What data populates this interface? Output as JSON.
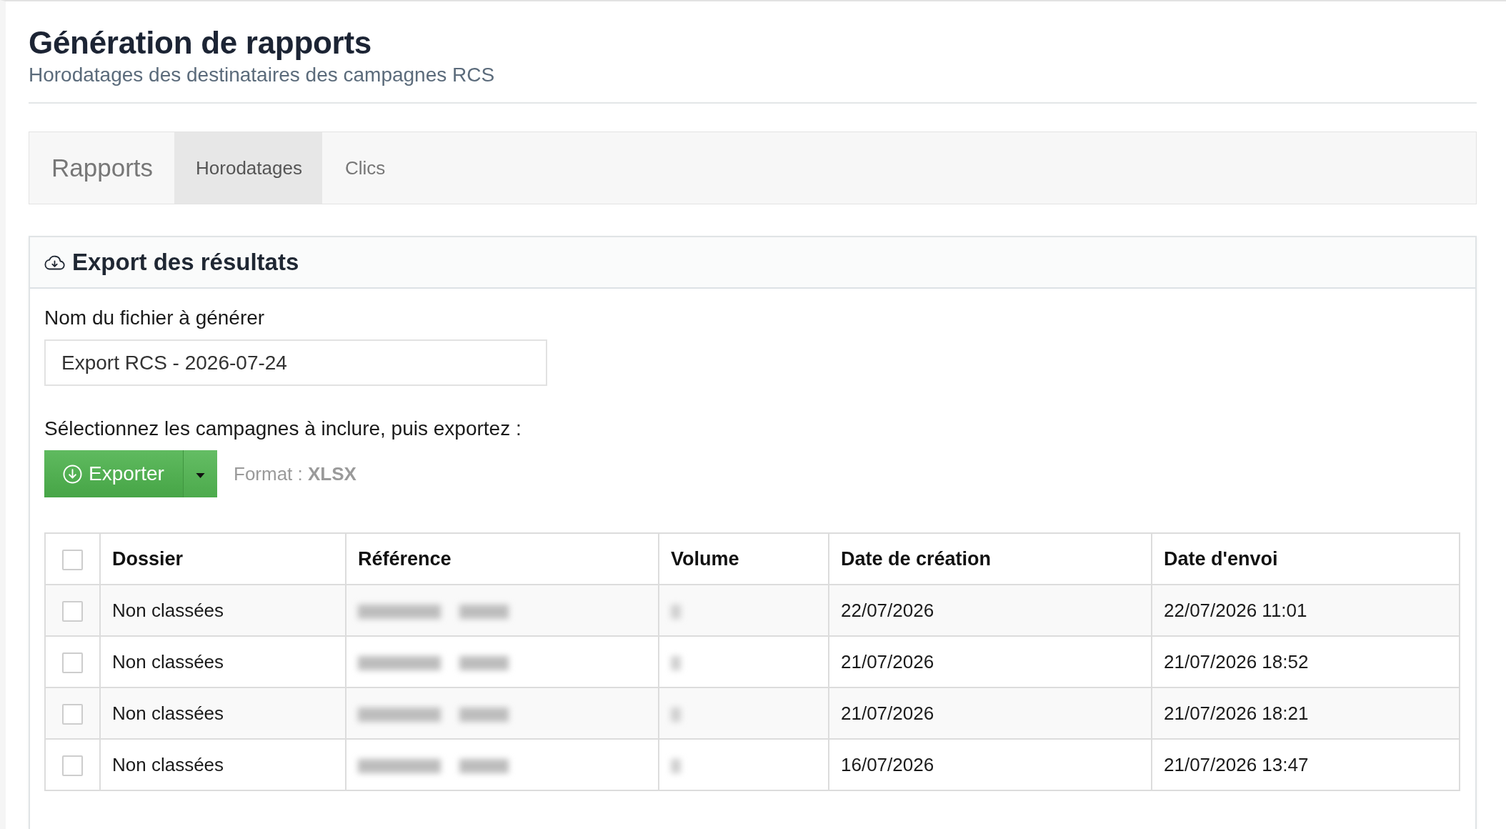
{
  "header": {
    "title": "Génération de rapports",
    "subtitle": "Horodatages des destinataires des campagnes RCS"
  },
  "nav": {
    "brand": "Rapports",
    "tabs": [
      {
        "label": "Horodatages",
        "selected": true
      },
      {
        "label": "Clics",
        "selected": false
      }
    ]
  },
  "export_panel": {
    "title": "Export des résultats",
    "filename_label": "Nom du fichier à générer",
    "filename_value": "Export RCS - 2026-07-24",
    "instructions": "Sélectionnez les campagnes à inclure, puis exportez :",
    "export_button": "Exporter",
    "format_note": "Format : **XLSX**"
  },
  "table": {
    "select_all_checked": false,
    "columns": [
      {
        "label": "Dossier",
        "kind": "text"
      },
      {
        "label": "Référence",
        "kind": "redacted"
      },
      {
        "label": "Volume",
        "kind": "redacted"
      },
      {
        "label": "Date de création",
        "kind": "text"
      },
      {
        "label": "Date d'envoi",
        "kind": "text"
      }
    ],
    "rows": [
      {
        "checked": false,
        "cells": [
          "Non classées",
          "22/07/2026",
          "22/07/2026 11:01"
        ]
      },
      {
        "checked": false,
        "cells": [
          "Non classées",
          "21/07/2026",
          "21/07/2026 18:52"
        ]
      },
      {
        "checked": false,
        "cells": [
          "Non classées",
          "21/07/2026",
          "21/07/2026 18:21"
        ]
      },
      {
        "checked": false,
        "cells": [
          "Non classées",
          "16/07/2026",
          "21/07/2026 13:47"
        ]
      }
    ]
  }
}
